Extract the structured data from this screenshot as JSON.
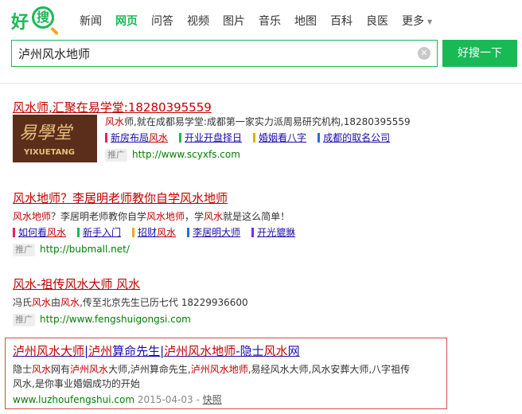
{
  "logo": {
    "part1": "好",
    "part2": "搜"
  },
  "nav": {
    "items": [
      "新闻",
      "网页",
      "问答",
      "视频",
      "图片",
      "音乐",
      "地图",
      "百科",
      "良医"
    ],
    "active": "网页",
    "more": "更多"
  },
  "search": {
    "value": "泸州风水地师",
    "button": "好搜一下"
  },
  "results": [
    {
      "title": "风水师,汇聚在易学堂:18280395559",
      "desc": "风水师,就在成都易学堂:成都第一家实力派周易研究机构,18280395559",
      "sublinks": [
        {
          "a": "新房布局",
          "b": "风水",
          "color": "#e0245e"
        },
        {
          "a": "开业开盘择日",
          "b": "",
          "color": "#19b955"
        },
        {
          "a": "婚姻看八字",
          "b": "",
          "color": "#d6b400"
        },
        {
          "a": "成都的取名公司",
          "b": "",
          "color": "#2a6de0"
        }
      ],
      "ad": "推广",
      "url": "http://www.scyxfs.com",
      "thumb_text": "YIXUETANG"
    },
    {
      "title": "风水地师？李居明老师教你自学风水地师",
      "desc": "风水地师？李居明老师教你自学风水地师，学风水就是这么简单！",
      "sublinks": [
        {
          "a": "如何看",
          "b": "风水",
          "color": "#e0245e"
        },
        {
          "a": "新手入门",
          "b": "",
          "color": "#19b955"
        },
        {
          "a": "招财",
          "b": "风水",
          "color": "#f5a623"
        },
        {
          "a": "李居明大师",
          "b": "",
          "color": "#2a6de0"
        },
        {
          "a": "开光貔貅",
          "b": "",
          "color": "#7b2ae0"
        }
      ],
      "ad": "推广",
      "url": "http://bubmall.net/"
    },
    {
      "title": "风水-祖传风水大师 风水",
      "desc": "冯氏风水由风水,传至北京先生已历七代 18229936600",
      "ad": "推广",
      "url": "http://www.fengshuigongsi.com"
    },
    {
      "title": "泸州风水大师|泸州算命先生|泸州风水地师-隐士风水网",
      "desc_line1": "隐士风水网有泸州风水大师,泸州算命先生,泸州风水地师,易经风水大师,风水安葬大师,八字祖传",
      "desc_line2": "风水,是你事业婚姻成功的开始",
      "url": "www.luzhoufengshui.com",
      "date": "2015-04-03",
      "snapshot": "快照"
    }
  ]
}
